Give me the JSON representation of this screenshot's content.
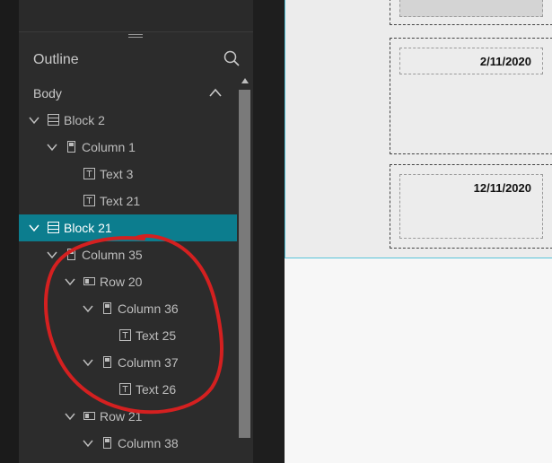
{
  "outline": {
    "title": "Outline",
    "section": "Body"
  },
  "tree": [
    {
      "label": "Block 2",
      "depth": 0,
      "chevron": true,
      "icon": "block-icon"
    },
    {
      "label": "Column 1",
      "depth": 1,
      "chevron": true,
      "icon": "column-icon"
    },
    {
      "label": "Text 3",
      "depth": 2,
      "chevron": false,
      "icon": "text-icon"
    },
    {
      "label": "Text 21",
      "depth": 2,
      "chevron": false,
      "icon": "text-icon"
    },
    {
      "label": "Block 21",
      "depth": 0,
      "chevron": true,
      "icon": "block-icon",
      "selected": true
    },
    {
      "label": "Column 35",
      "depth": 1,
      "chevron": true,
      "icon": "column-icon"
    },
    {
      "label": "Row 20",
      "depth": 2,
      "chevron": true,
      "icon": "row-icon"
    },
    {
      "label": "Column 36",
      "depth": 3,
      "chevron": true,
      "icon": "column-icon"
    },
    {
      "label": "Text 25",
      "depth": 4,
      "chevron": false,
      "icon": "text-icon"
    },
    {
      "label": "Column 37",
      "depth": 3,
      "chevron": true,
      "icon": "column-icon"
    },
    {
      "label": "Text 26",
      "depth": 4,
      "chevron": false,
      "icon": "text-icon"
    },
    {
      "label": "Row 21",
      "depth": 2,
      "chevron": true,
      "icon": "row-icon"
    },
    {
      "label": "Column 38",
      "depth": 3,
      "chevron": true,
      "icon": "column-icon"
    }
  ],
  "canvas": {
    "dates": [
      "2/11/2020",
      "12/11/2020"
    ]
  },
  "colors": {
    "selected_row": "#0c7d8e",
    "annotation": "#d42020",
    "page_border": "#58c4d9"
  }
}
